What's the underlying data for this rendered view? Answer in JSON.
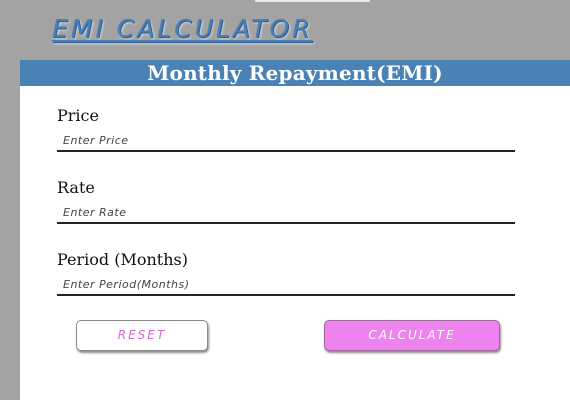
{
  "app": {
    "title": "EMI CALCULATOR"
  },
  "form": {
    "header": "Monthly Repayment(EMI)",
    "fields": [
      {
        "label": "Price",
        "placeholder": "Enter Price",
        "value": ""
      },
      {
        "label": "Rate",
        "placeholder": "Enter Rate",
        "value": ""
      },
      {
        "label": "Period (Months)",
        "placeholder": "Enter Period(Months)",
        "value": ""
      }
    ],
    "buttons": {
      "reset": "RESET",
      "calculate": "CALCULATE"
    }
  },
  "colors": {
    "title": "#4b7fb6",
    "header_bar": "#4a82b5",
    "background": "#a3a3a3",
    "panel": "#ffffff",
    "reset_text": "#d268d2",
    "calculate_bg": "#ee82ee"
  }
}
